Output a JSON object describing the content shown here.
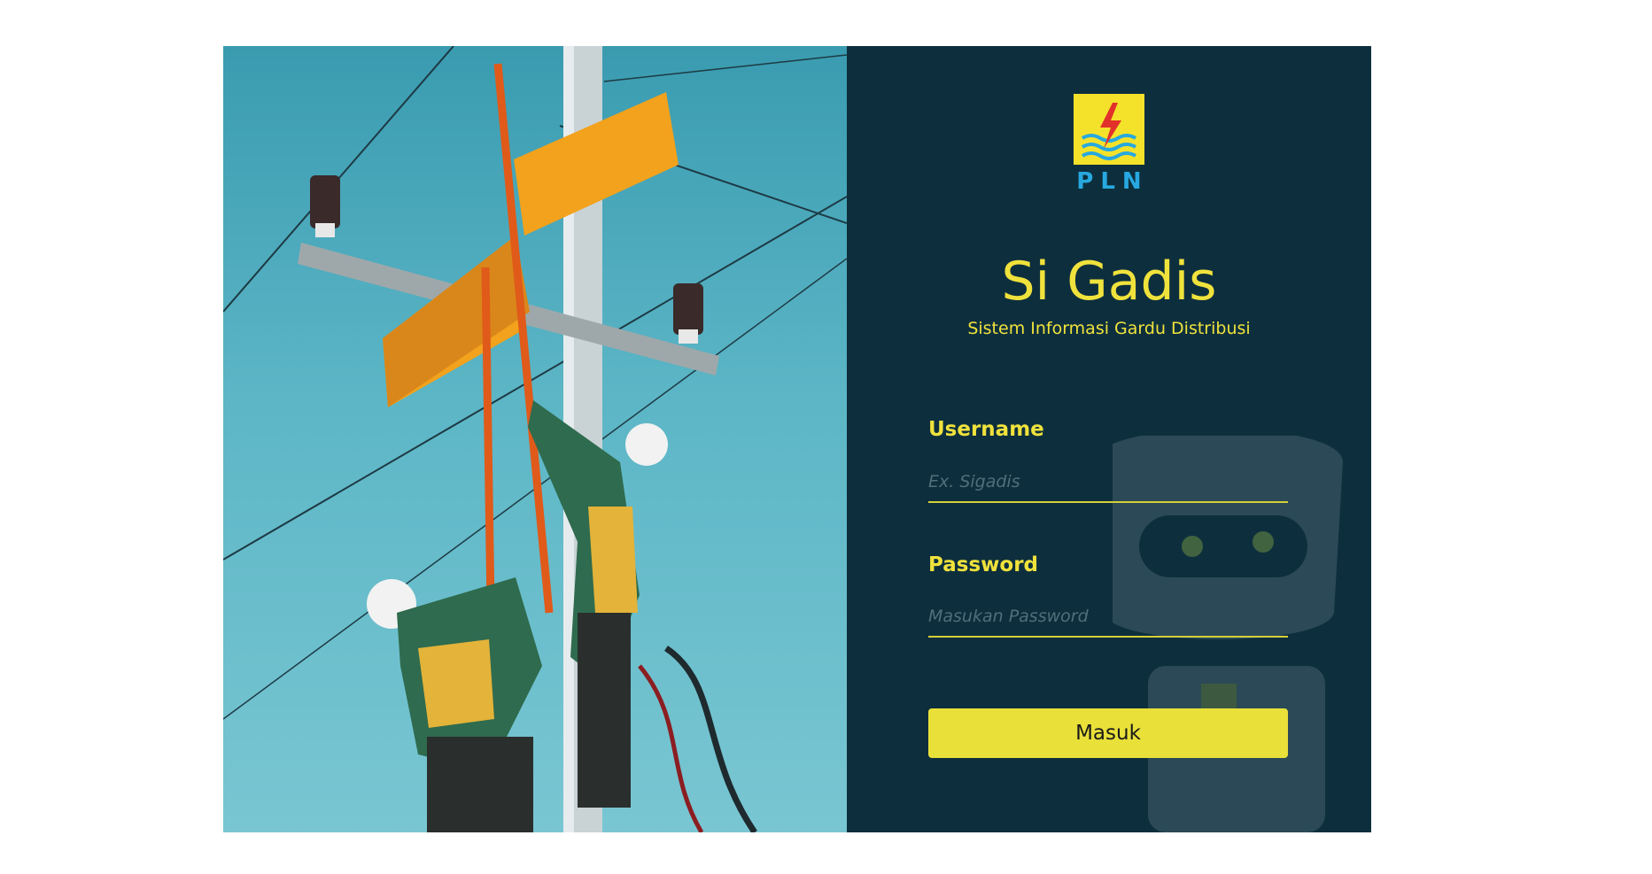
{
  "brand": {
    "logo_icon": "pln-lightning-logo",
    "logo_text": "PLN",
    "colors": {
      "logo_yellow": "#f4e22a",
      "logo_blue": "#27a8e0",
      "accent_red": "#e2312a"
    }
  },
  "hero": {
    "image": "utility-workers-on-power-pole"
  },
  "login": {
    "title": "Si Gadis",
    "subtitle": "Sistem Informasi Gardu Distribusi",
    "username": {
      "label": "Username",
      "placeholder": "Ex. Sigadis",
      "value": ""
    },
    "password": {
      "label": "Password",
      "placeholder": "Masukan Password",
      "value": ""
    },
    "submit_label": "Masuk",
    "mascot": "robot-mascot"
  },
  "theme": {
    "panel_bg": "#0d2f3d",
    "accent": "#f0e23c",
    "button_bg": "#e9e03a"
  }
}
